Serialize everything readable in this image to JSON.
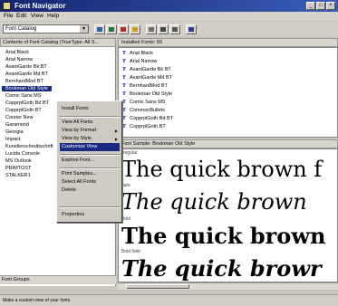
{
  "window": {
    "title": "Font Navigator",
    "controls": [
      "_",
      "□",
      "×"
    ]
  },
  "menu": [
    "File",
    "Edit",
    "View",
    "Help"
  ],
  "toolbar": {
    "catalog_combo": "Font Catalog",
    "icons": [
      "install-fonts-icon",
      "uninstall-fonts-icon",
      "delete-icon",
      "add-group-icon",
      "view-icon",
      "sample-view-icon",
      "print-icon",
      "help-icon"
    ]
  },
  "left_pane": {
    "header": "Contents of Font Catalog  (TrueType: All S...",
    "fonts": [
      "Arial Black",
      "Arial Narrow",
      "AvantGarde Bk BT",
      "AvantGarde Md BT",
      "BernhardMod BT",
      "Bookman Old Style",
      "Comic Sans MS",
      "CopprplGoth Bd BT",
      "CopprplGoth BT",
      "Courier New",
      "Garamond",
      "Georgia",
      "Impact",
      "Kunstlerschreibschrift",
      "Lucida Console",
      "MS Outlook",
      "PRIMTOST",
      "STALKER1"
    ],
    "selected_index": 5,
    "groups_header": "Font Groups"
  },
  "installed": {
    "header": "Installed Fonts: 83",
    "fonts": [
      "Arial Black",
      "Arial Narrow",
      "AvantGarde Bk BT",
      "AvantGarde Md BT",
      "BernhardMod BT",
      "Bookman Old Style",
      "Comic Sans MS",
      "CommonBullets",
      "CopprplGoth Bd BT",
      "CopprplGoth BT"
    ]
  },
  "sample": {
    "header": "Font Sample:  Bookman Old Style",
    "text": "The quick brown f",
    "styles": [
      {
        "label": "Regular",
        "text": "The quick brown f"
      },
      {
        "label": "Italic",
        "text": "The quick brown"
      },
      {
        "label": "Bold",
        "text": "The quick brown"
      },
      {
        "label": "Bold Italic",
        "text": "The quick browr"
      }
    ]
  },
  "context_menu": {
    "items": [
      "Install Fonts",
      "View All Fonts",
      "View by Format",
      "View by Style",
      "Customize View",
      "Explore Font...",
      "Print Samples...",
      "Select All Fonts",
      "Delete",
      "Properties"
    ],
    "highlighted": "Customize View"
  },
  "status": "Make a custom view of your fonts"
}
